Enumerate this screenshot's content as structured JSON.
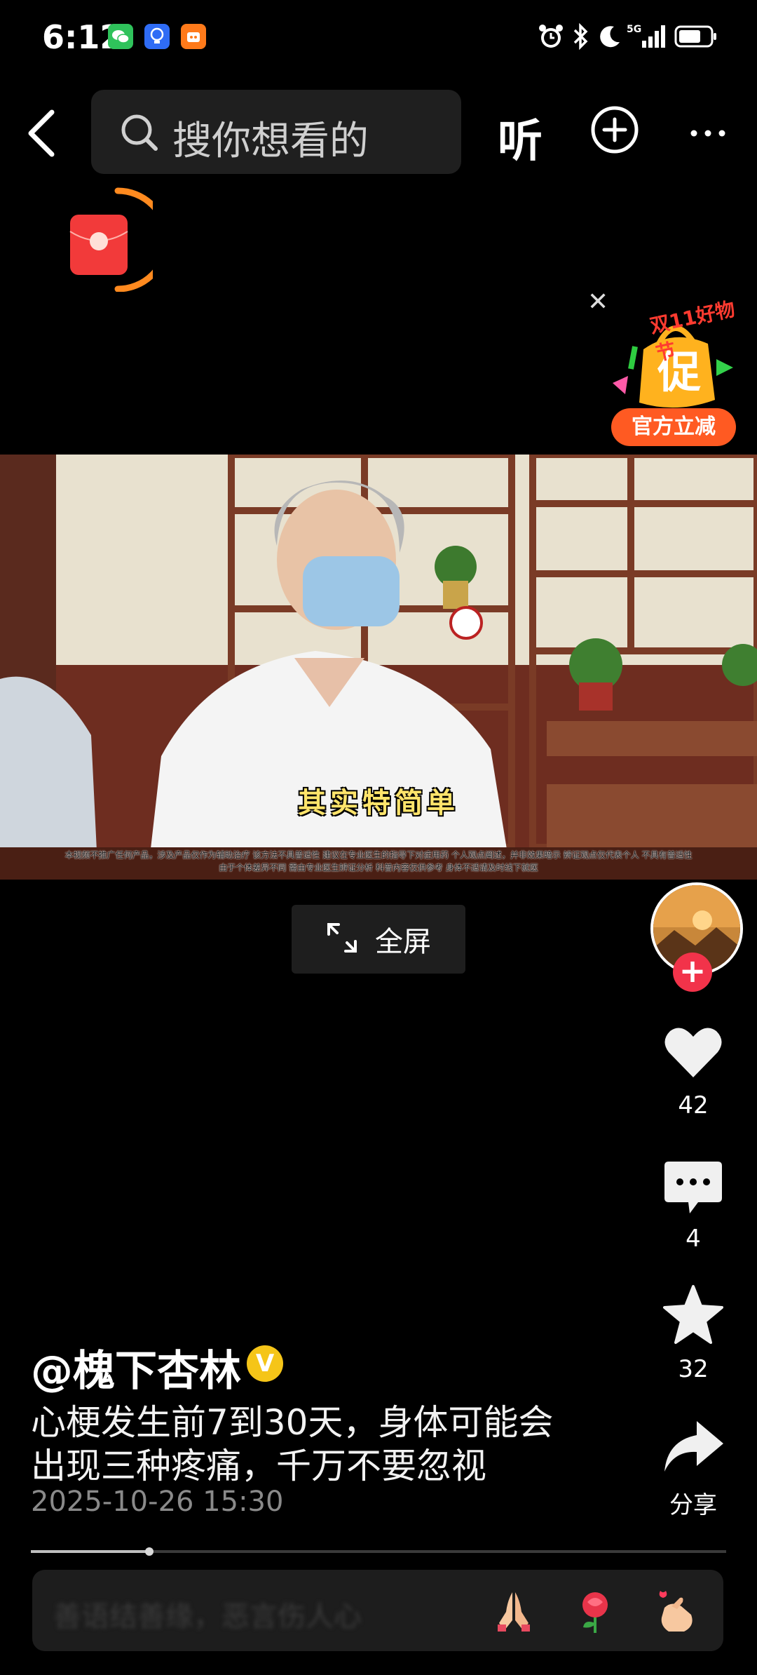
{
  "status_bar": {
    "time": "6:12",
    "network": "5G"
  },
  "top_bar": {
    "search_placeholder": "搜你想看的",
    "listen_label": "听"
  },
  "promo": {
    "top_text": "双11好物节",
    "badge_char": "促",
    "ribbon_text": "官方立减"
  },
  "video": {
    "subtitle": "其实特简单",
    "disclaimer_line1": "本视频不推广任何产品，涉及产品仅作为辅助治疗 该方法不具普适性 建议在专业医生的指导下对症用药 个人观点阐述，并非效果暗示 辨证观点仅代表个人 不具有普适性",
    "disclaimer_line2": "由于个体差异不同 需由专业医生辨证分析 科普内容仅供参考 身体不适请及时线下就医",
    "fullscreen_label": "全屏",
    "progress": 0.17
  },
  "rail": {
    "likes": "42",
    "comments": "4",
    "favorites": "32",
    "share_label": "分享"
  },
  "post": {
    "author": "@槐下杏林",
    "verified_mark": "V",
    "description_line1": "心梗发生前7到30天，身体可能会",
    "description_line2": "出现三种疼痛，千万不要忽视",
    "date": "2025-10-26 15:30"
  },
  "comment_bar": {
    "placeholder": "善语结善缘，恶言伤人心"
  },
  "colors": {
    "accent_red": "#f2334a",
    "promo_orange": "#ff5a22",
    "verified_gold": "#f5c518",
    "subtitle_yellow": "#ffe46b"
  }
}
